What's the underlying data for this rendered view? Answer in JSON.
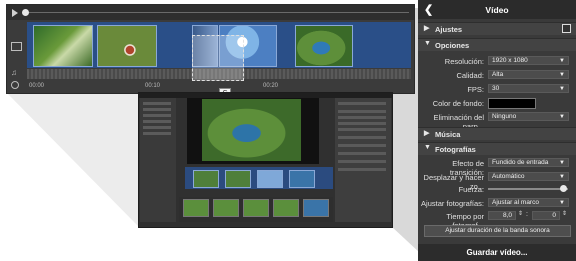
{
  "timeline": {
    "ruler": [
      "00:00",
      "00:10",
      "00:20"
    ],
    "cursor_badge": "C"
  },
  "panel": {
    "title": "Vídeo",
    "sections": {
      "ajustes": "Ajustes",
      "opciones": "Opciones",
      "musica": "Música",
      "fotografias": "Fotografías"
    },
    "opciones": {
      "resolucion_label": "Resolución:",
      "resolucion_value": "1920 x 1080",
      "calidad_label": "Calidad:",
      "calidad_value": "Alta",
      "fps_label": "FPS:",
      "fps_value": "30",
      "color_label": "Color de fondo:",
      "color_value": "#000000",
      "elim_label": "Eliminación del parp...",
      "elim_value": "Ninguno"
    },
    "fotografias": {
      "efecto_label": "Efecto de transición:",
      "efecto_value": "Fundido de entrada",
      "desplazar_label": "Desplazar y hacer zo...",
      "desplazar_value": "Automático",
      "fuerza_label": "Fuerza:",
      "fuerza_level": 0.95,
      "ajustar_label": "Ajustar fotografías:",
      "ajustar_value": "Ajustar al marco",
      "tiempo_label": "Tiempo por fotograf...",
      "tiempo_value": "8,0",
      "tiempo_value2": "0",
      "ajustar_btn": "Ajustar duración de la banda sonora"
    },
    "save_button": "Guardar vídeo..."
  },
  "colors": {
    "timeline_blue": "#2a4f88",
    "panel_bg": "#3a3a3a"
  }
}
